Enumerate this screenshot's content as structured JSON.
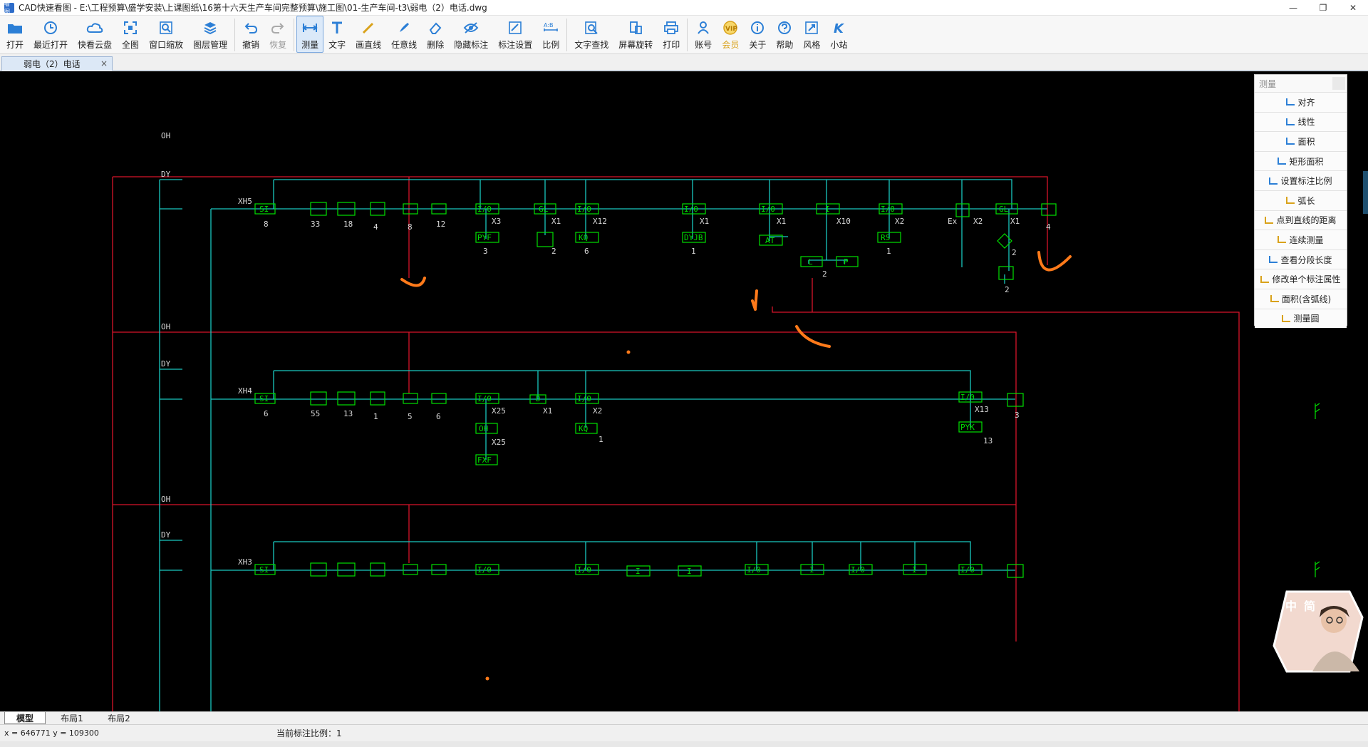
{
  "window": {
    "title": "CAD快速看图 - E:\\工程预算\\盛学安装\\上课图纸\\16第十六天生产车间完整预算\\施工图\\01-生产车间-t3\\弱电（2）电话.dwg",
    "app_icon_text": "看图",
    "minimize": "—",
    "restore": "❐",
    "close": "✕"
  },
  "toolbar": [
    {
      "id": "open",
      "label": "打开",
      "icon": "folder-icon"
    },
    {
      "id": "recent",
      "label": "最近打开",
      "icon": "clock-icon"
    },
    {
      "id": "cloud",
      "label": "快看云盘",
      "icon": "cloud-icon"
    },
    {
      "id": "fit",
      "label": "全图",
      "icon": "fit-icon"
    },
    {
      "id": "zoom",
      "label": "窗口缩放",
      "icon": "zoom-icon"
    },
    {
      "id": "layers",
      "label": "图层管理",
      "icon": "layers-icon"
    },
    {
      "id": "undo",
      "label": "撤销",
      "icon": "undo-icon"
    },
    {
      "id": "redo",
      "label": "恢复",
      "icon": "redo-icon"
    },
    {
      "id": "measure",
      "label": "测量",
      "icon": "measure-icon"
    },
    {
      "id": "text",
      "label": "文字",
      "icon": "text-icon"
    },
    {
      "id": "line",
      "label": "画直线",
      "icon": "pencil-icon"
    },
    {
      "id": "freeline",
      "label": "任意线",
      "icon": "brush-icon"
    },
    {
      "id": "erase",
      "label": "删除",
      "icon": "eraser-icon"
    },
    {
      "id": "hide",
      "label": "隐藏标注",
      "icon": "eye-off-icon"
    },
    {
      "id": "markset",
      "label": "标注设置",
      "icon": "mark-settings-icon"
    },
    {
      "id": "ratio",
      "label": "比例",
      "icon": "ratio-icon"
    },
    {
      "id": "findtext",
      "label": "文字查找",
      "icon": "find-text-icon"
    },
    {
      "id": "rotate",
      "label": "屏幕旋转",
      "icon": "rotate-icon"
    },
    {
      "id": "print",
      "label": "打印",
      "icon": "printer-icon"
    },
    {
      "id": "account",
      "label": "账号",
      "icon": "user-icon"
    },
    {
      "id": "vip",
      "label": "会员",
      "icon": "vip-icon"
    },
    {
      "id": "about",
      "label": "关于",
      "icon": "info-icon"
    },
    {
      "id": "help",
      "label": "帮助",
      "icon": "help-icon"
    },
    {
      "id": "style",
      "label": "风格",
      "icon": "style-icon"
    },
    {
      "id": "site",
      "label": "小站",
      "icon": "k-logo-icon"
    }
  ],
  "tabs": {
    "document": "弱电（2）电话",
    "close": "×"
  },
  "measure_panel": {
    "title": "测量",
    "items": [
      "对齐",
      "线性",
      "面积",
      "矩形面积",
      "设置标注比例",
      "弧长",
      "点到直线的距离",
      "连续测量",
      "查看分段长度",
      "修改单个标注属性",
      "面积(含弧线)",
      "测量圆"
    ]
  },
  "layout_tabs": [
    "模型",
    "布局1",
    "布局2"
  ],
  "status": {
    "coords": "x = 646771  y = 109300",
    "scale": "当前标注比例：1"
  },
  "avatar": {
    "text1": "中",
    "text2": "简"
  },
  "drawing": {
    "row1": {
      "trunk_oh": "OH",
      "trunk_dy": "DY",
      "panel": "XH5",
      "nodes": [
        "SI",
        "I/0",
        "GL",
        "I/0",
        "I/0",
        "I/0",
        "I",
        "I/0",
        "GL"
      ],
      "node_labels": [
        "X3",
        "X1",
        "X12",
        "X1",
        "X1",
        "X10",
        "X2",
        "X2",
        "X1",
        "Ex"
      ],
      "boxes": [
        "PYF",
        "KQ",
        "DYJB",
        "AT",
        "L",
        "P",
        "RS"
      ],
      "nums": [
        "8",
        "33",
        "18",
        "4",
        "8",
        "12",
        "3",
        "2",
        "6",
        "1",
        "2",
        "1",
        "4",
        "2",
        "2"
      ]
    },
    "row2": {
      "trunk_oh": "OH",
      "trunk_dy": "DY",
      "panel": "XH4",
      "nodes": [
        "SI",
        "I/0",
        "D",
        "I/0",
        "I/0"
      ],
      "node_labels": [
        "X25",
        "X1",
        "X2",
        "X13",
        "X25"
      ],
      "boxes": [
        "OH",
        "KQ",
        "PYK",
        "FXF"
      ],
      "nums": [
        "6",
        "55",
        "13",
        "1",
        "5",
        "6",
        "1",
        "3",
        "13"
      ]
    },
    "row3": {
      "trunk_oh": "OH",
      "trunk_dy": "DY",
      "panel": "XH3",
      "nodes": [
        "SI",
        "I/0",
        "I/0",
        "I",
        "I",
        "I/0",
        "I",
        "I/0",
        "I",
        "I/0"
      ]
    }
  }
}
